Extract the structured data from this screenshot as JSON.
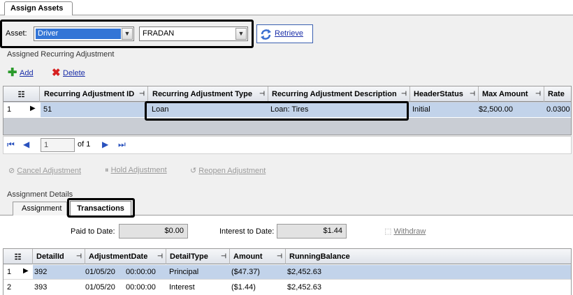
{
  "tabs": {
    "main": "Assign Assets"
  },
  "asset": {
    "label": "Asset:",
    "type_value": "Driver",
    "code_value": "FRADAN",
    "retrieve": "Retrieve"
  },
  "recurring": {
    "section_title": "Assigned Recurring Adjustment",
    "add": "Add",
    "delete": "Delete",
    "columns": [
      "Recurring Adjustment ID",
      "Recurring Adjustment Type",
      "Recurring Adjustment Description",
      "HeaderStatus",
      "Max Amount",
      "Rate"
    ],
    "rows": [
      {
        "num": "1",
        "id": "51",
        "type": "Loan",
        "description": "Loan: Tires",
        "status": "Initial",
        "max_amount": "$2,500.00",
        "rate": "0.0300"
      }
    ]
  },
  "pager": {
    "current": "1",
    "of_label": "of 1"
  },
  "actions": {
    "cancel": "Cancel Adjustment",
    "hold": "Hold Adjustment",
    "reopen": "Reopen Adjustment"
  },
  "details": {
    "section_title": "Assignment Details",
    "tab_assignment": "Assignment",
    "tab_transactions": "Transactions",
    "paid_label": "Paid to Date:",
    "paid_value": "$0.00",
    "interest_label": "Interest to Date:",
    "interest_value": "$1.44",
    "withdraw": "Withdraw",
    "columns": [
      "DetailId",
      "AdjustmentDate",
      "DetailType",
      "Amount",
      "RunningBalance"
    ],
    "rows": [
      {
        "num": "1",
        "id": "392",
        "date": "01/05/20",
        "time": "00:00:00",
        "type": "Principal",
        "amount": "($47.37)",
        "balance": "$2,452.63"
      },
      {
        "num": "2",
        "id": "393",
        "date": "01/05/20",
        "time": "00:00:00",
        "type": "Interest",
        "amount": "($1.44)",
        "balance": "$2,452.63"
      }
    ]
  },
  "colors": {
    "selection": "#c2d3ea",
    "combo_highlight": "#3375d6",
    "link": "#1a2ea8"
  }
}
